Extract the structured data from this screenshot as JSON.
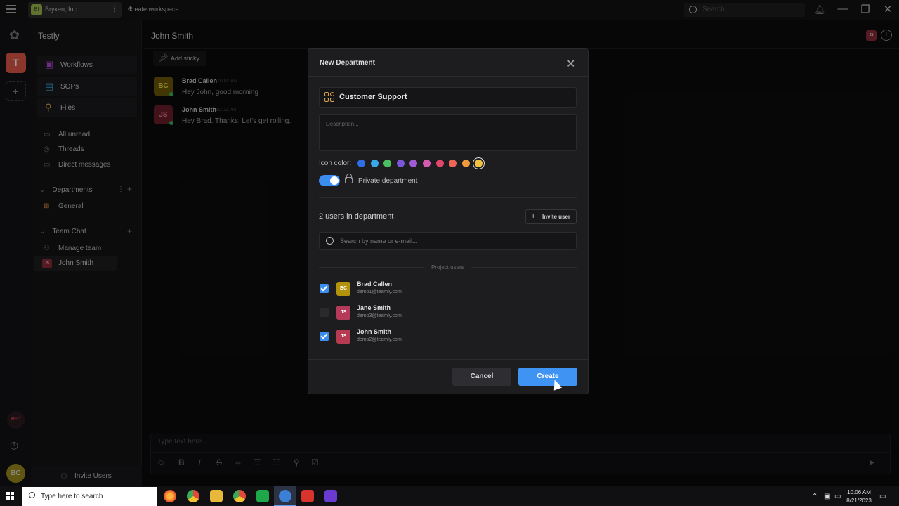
{
  "titlebar": {
    "workspace_initials": "BI",
    "workspace_name": "Bryxen, Inc.",
    "create_workspace": "Create workspace",
    "search_placeholder": "Search..."
  },
  "rail": {
    "current_workspace_initial": "T",
    "rec_label": "REC",
    "user_initials": "BC"
  },
  "sidebar": {
    "title": "Testly",
    "top_items": [
      {
        "label": "Workflows",
        "icon": "workflow-icon"
      },
      {
        "label": "SOPs",
        "icon": "sop-icon"
      },
      {
        "label": "Files",
        "icon": "paperclip-icon"
      }
    ],
    "items": [
      "All unread",
      "Threads",
      "Direct messages"
    ],
    "departments_label": "Departments",
    "departments": [
      "General"
    ],
    "team_chat_label": "Team Chat",
    "team_items": [
      "Manage team",
      "John Smith"
    ],
    "john_initials": "JS",
    "invite_users": "Invite Users"
  },
  "chat": {
    "title": "John Smith",
    "header_avatar": "JS",
    "add_sticky": "Add sticky",
    "messages": [
      {
        "initials": "BC",
        "name": "Brad Callen",
        "time": "10:02 AM",
        "text": "Hey John, good morning"
      },
      {
        "initials": "JS",
        "name": "John Smith",
        "time": "10:02 AM",
        "text": "Hey Brad. Thanks. Let's get rolling."
      }
    ],
    "composer_placeholder": "Type text here..."
  },
  "modal": {
    "title": "New Department",
    "name_value": "Customer Support",
    "description_placeholder": "Description...",
    "icon_color_label": "Icon color:",
    "colors": [
      "#2f6fe6",
      "#3aa8e8",
      "#4cbf63",
      "#7a56d8",
      "#a05ad6",
      "#d65cb0",
      "#e2466b",
      "#ee6656",
      "#ef9a3c",
      "#f0c23e"
    ],
    "selected_color": "#f0c23e",
    "private_label": "Private department",
    "private_on": true,
    "users_count": "2 users in department",
    "invite_user": "Invite user",
    "search_placeholder": "Search by name or e-mail...",
    "project_users_label": "Project users",
    "users": [
      {
        "initials": "BC",
        "name": "Brad Callen",
        "email": "demo1@teamly.com",
        "checked": true,
        "color": "#b3930c"
      },
      {
        "initials": "JS",
        "name": "Jane Smith",
        "email": "demo3@teamly.com",
        "checked": false,
        "color": "#b53a5a"
      },
      {
        "initials": "JS",
        "name": "John Smith",
        "email": "demo2@teamly.com",
        "checked": true,
        "color": "#b53a52"
      }
    ],
    "cancel": "Cancel",
    "create": "Create"
  },
  "taskbar": {
    "search_text": "Type here to search",
    "time": "10:06 AM",
    "date": "8/21/2023"
  }
}
